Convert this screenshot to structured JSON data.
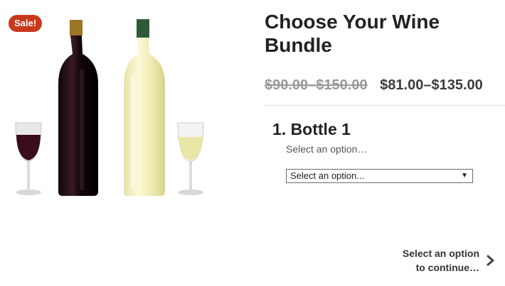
{
  "badge": {
    "sale": "Sale!"
  },
  "product": {
    "title": "Choose Your Wine Bundle",
    "old_price": "$90.00–$150.00",
    "new_price": "$81.00–$135.00"
  },
  "bundle": {
    "item_heading": "1. Bottle 1",
    "item_hint": "Select an option…",
    "select_value": "Select an option..."
  },
  "footer": {
    "continue_line1": "Select an option",
    "continue_line2": "to continue…"
  },
  "colors": {
    "badge": "#c8391b",
    "red_wine": "#3a0c1c",
    "white_wine": "#f1f0bd"
  },
  "icons": {
    "chevron": "chevron-right-icon",
    "select_arrow": "caret-down-icon"
  }
}
